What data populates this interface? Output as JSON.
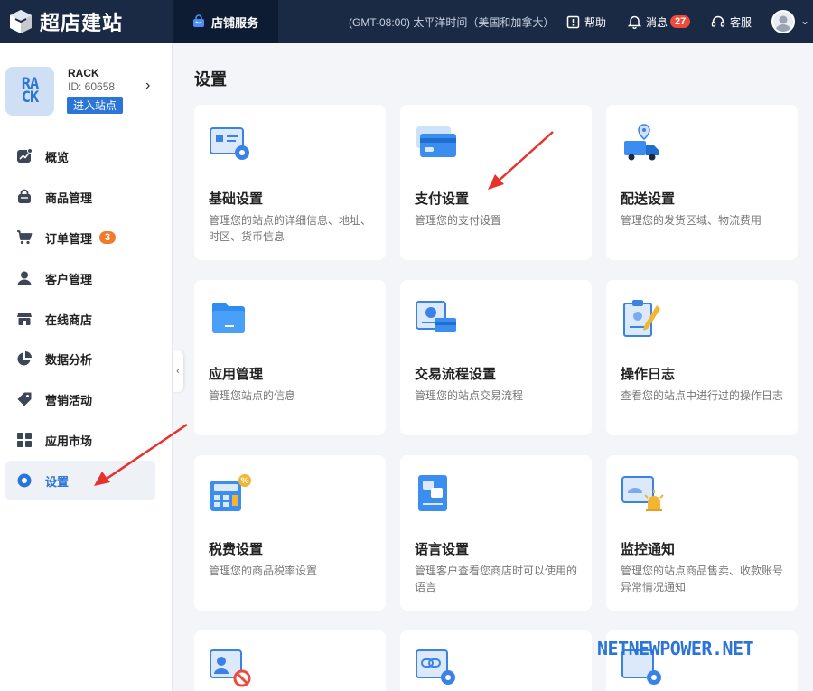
{
  "app": {
    "title": "超店建站"
  },
  "topbar": {
    "service_tab": "店铺服务",
    "timezone": "(GMT-08:00) 太平洋时间（美国和加拿大）",
    "help": "帮助",
    "messages": "消息",
    "messages_count": "27",
    "support": "客服"
  },
  "store": {
    "logo_text_line1": "RA",
    "logo_text_line2": "CK",
    "name": "RACK",
    "id": "ID: 60658",
    "enter": "进入站点"
  },
  "sidebar": {
    "items": [
      {
        "label": "概览",
        "icon": "chart-icon"
      },
      {
        "label": "商品管理",
        "icon": "bag-icon"
      },
      {
        "label": "订单管理",
        "icon": "cart-icon",
        "badge": "3"
      },
      {
        "label": "客户管理",
        "icon": "user-icon"
      },
      {
        "label": "在线商店",
        "icon": "store-icon"
      },
      {
        "label": "数据分析",
        "icon": "pie-icon"
      },
      {
        "label": "营销活动",
        "icon": "tag-icon"
      },
      {
        "label": "应用市场",
        "icon": "grid-icon"
      },
      {
        "label": "设置",
        "icon": "settings-icon",
        "active": true
      }
    ]
  },
  "main": {
    "title": "设置",
    "cards": [
      {
        "title": "基础设置",
        "desc": "管理您的站点的详细信息、地址、时区、货币信息"
      },
      {
        "title": "支付设置",
        "desc": "管理您的支付设置"
      },
      {
        "title": "配送设置",
        "desc": "管理您的发货区域、物流费用"
      },
      {
        "title": "应用管理",
        "desc": "管理您站点的信息"
      },
      {
        "title": "交易流程设置",
        "desc": "管理您的站点交易流程"
      },
      {
        "title": "操作日志",
        "desc": "查看您的站点中进行过的操作日志"
      },
      {
        "title": "税费设置",
        "desc": "管理您的商品税率设置"
      },
      {
        "title": "语言设置",
        "desc": "管理客户查看您商店时可以使用的语言"
      },
      {
        "title": "监控通知",
        "desc": "管理您的站点商品售卖、收款账号异常情况通知"
      }
    ]
  },
  "watermark": "NETNEWPOWER.NET",
  "colors": {
    "accent": "#2b74d8",
    "topbar": "#1b2a44",
    "arrow": "#e8312a",
    "badge_orange": "#f07b2c",
    "badge_red": "#f04a3a"
  }
}
